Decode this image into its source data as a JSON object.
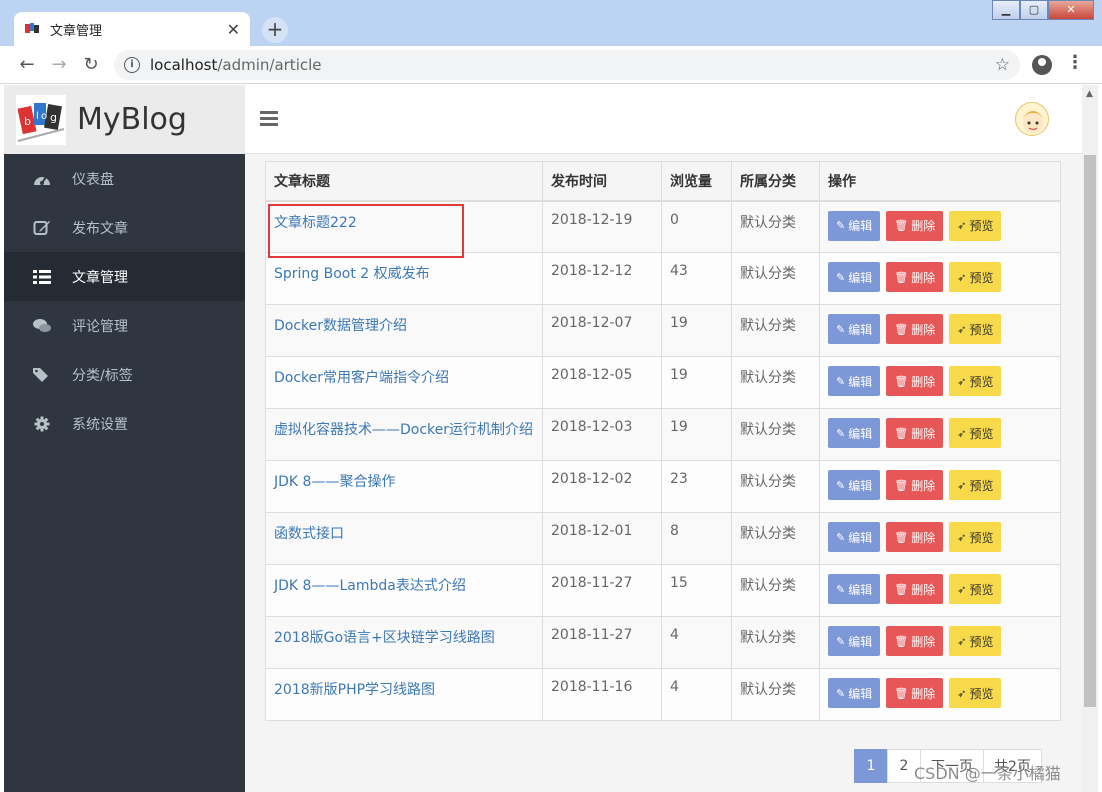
{
  "browser": {
    "tab_title": "文章管理",
    "url_host": "localhost",
    "url_path": "/admin/article"
  },
  "app": {
    "logo_text": "MyBlog"
  },
  "sidebar": {
    "items": [
      {
        "label": "仪表盘",
        "icon": "dashboard-icon"
      },
      {
        "label": "发布文章",
        "icon": "edit-icon"
      },
      {
        "label": "文章管理",
        "icon": "list-icon",
        "active": true
      },
      {
        "label": "评论管理",
        "icon": "comments-icon"
      },
      {
        "label": "分类/标签",
        "icon": "tags-icon"
      },
      {
        "label": "系统设置",
        "icon": "gear-icon"
      }
    ]
  },
  "table": {
    "headers": [
      "文章标题",
      "发布时间",
      "浏览量",
      "所属分类",
      "操作"
    ],
    "rows": [
      {
        "title": "文章标题222",
        "date": "2018-12-19",
        "views": "0",
        "category": "默认分类"
      },
      {
        "title": "Spring Boot 2 权威发布",
        "date": "2018-12-12",
        "views": "43",
        "category": "默认分类"
      },
      {
        "title": "Docker数据管理介绍",
        "date": "2018-12-07",
        "views": "19",
        "category": "默认分类"
      },
      {
        "title": "Docker常用客户端指令介绍",
        "date": "2018-12-05",
        "views": "19",
        "category": "默认分类"
      },
      {
        "title": "虚拟化容器技术——Docker运行机制介绍",
        "date": "2018-12-03",
        "views": "19",
        "category": "默认分类"
      },
      {
        "title": "JDK 8——聚合操作",
        "date": "2018-12-02",
        "views": "23",
        "category": "默认分类"
      },
      {
        "title": "函数式接口",
        "date": "2018-12-01",
        "views": "8",
        "category": "默认分类"
      },
      {
        "title": "JDK 8——Lambda表达式介绍",
        "date": "2018-11-27",
        "views": "15",
        "category": "默认分类"
      },
      {
        "title": "2018版Go语言+区块链学习线路图",
        "date": "2018-11-27",
        "views": "4",
        "category": "默认分类"
      },
      {
        "title": "2018新版PHP学习线路图",
        "date": "2018-11-16",
        "views": "4",
        "category": "默认分类"
      }
    ],
    "actions": {
      "edit": "编辑",
      "delete": "删除",
      "preview": "预览"
    }
  },
  "pager": {
    "pages": [
      "1",
      "2"
    ],
    "next": "下一页",
    "total": "共2页"
  },
  "watermark": "CSDN @一条小橘猫",
  "colors": {
    "sidebar_bg": "#2f3640",
    "edit_btn": "#7c98d6",
    "delete_btn": "#e85757",
    "preview_btn": "#f8d94a",
    "link": "#3c78b4",
    "highlight_box": "#e03a3a"
  }
}
